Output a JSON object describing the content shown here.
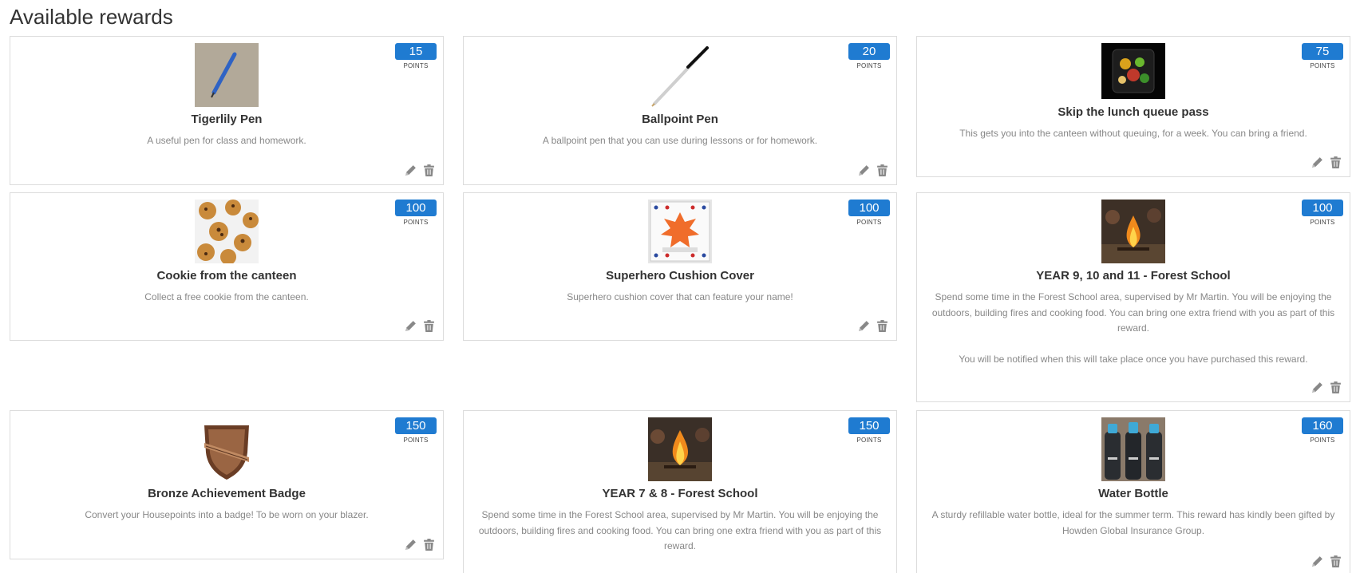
{
  "page": {
    "title": "Available rewards"
  },
  "points_label": "POINTS",
  "colors": {
    "badge": "#1f7bd1",
    "action_icon": "#888888"
  },
  "rewards": [
    {
      "points": "15",
      "title": "Tigerlily Pen",
      "description": "A useful pen for class and homework.",
      "image_icon": "blue-pen-image"
    },
    {
      "points": "20",
      "title": "Ballpoint Pen",
      "description": "A ballpoint pen that you can use during lessons or for homework.",
      "image_icon": "ballpoint-pen-image"
    },
    {
      "points": "75",
      "title": "Skip the lunch queue pass",
      "description": "This gets you into the canteen without queuing, for a week. You can bring a friend.",
      "image_icon": "lunch-box-image"
    },
    {
      "points": "100",
      "title": "Cookie from the canteen",
      "description": "Collect a free cookie from the canteen.",
      "image_icon": "cookies-image"
    },
    {
      "points": "100",
      "title": "Superhero Cushion Cover",
      "description": "Superhero cushion cover that can feature your name!",
      "image_icon": "cushion-image"
    },
    {
      "points": "100",
      "title": "YEAR 9, 10 and 11 - Forest School",
      "description": "Spend some time in the Forest School area, supervised by Mr Martin. You will be enjoying the outdoors, building fires and cooking food. You can bring one extra friend with you as part of this reward.\n\nYou will be notified when this will take place once you have purchased this reward.",
      "image_icon": "campfire-image"
    },
    {
      "points": "150",
      "title": "Bronze Achievement Badge",
      "description": "Convert your Housepoints into a badge! To be worn on your blazer.",
      "image_icon": "badge-image"
    },
    {
      "points": "150",
      "title": "YEAR 7 & 8 - Forest School",
      "description": "Spend some time in the Forest School area, supervised by Mr Martin. You will be enjoying the outdoors, building fires and cooking food. You can bring one extra friend with you as part of this reward.",
      "image_icon": "campfire-image"
    },
    {
      "points": "160",
      "title": "Water Bottle",
      "description": "A sturdy refillable water bottle, ideal for the summer term. This reward has kindly been gifted by Howden Global Insurance Group.",
      "image_icon": "water-bottles-image"
    }
  ]
}
